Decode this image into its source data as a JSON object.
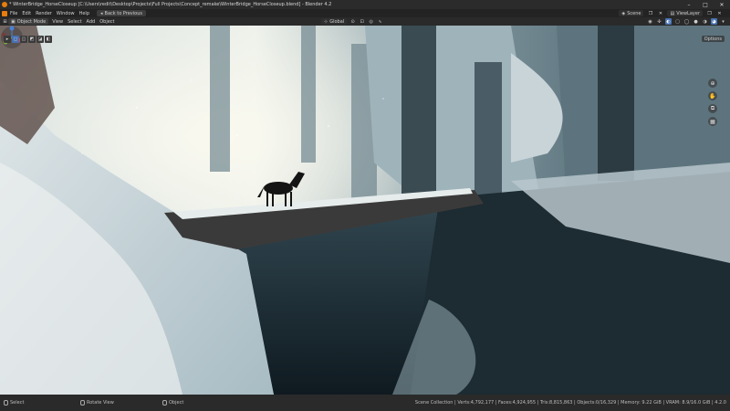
{
  "titlebar": {
    "title": "* WinterBridge_HorseCloseup [C:\\Users\\redit\\Desktop\\Projects\\Full Projects\\Concept_remake\\WinterBridge_HorseCloseup.blend] - Blender 4.2",
    "minimize": "–",
    "maximize": "□",
    "close": "✕"
  },
  "menubar": {
    "items": [
      "File",
      "Edit",
      "Render",
      "Window",
      "Help"
    ],
    "back_label": "Back to Previous",
    "scene": "Scene",
    "view_layer": "ViewLayer"
  },
  "viewport_header": {
    "mode": "Object Mode",
    "items": [
      "View",
      "Select",
      "Add",
      "Object"
    ],
    "orientation": "Global",
    "options": "Options"
  },
  "statusbar": {
    "select": "Select",
    "rotate": "Rotate View",
    "object": "Object",
    "stats": "Scene Collection | Verts:4,792,177 | Faces:4,924,955 | Tris:8,815,863 | Objects:0/16,329 | Memory: 9.22 GiB | VRAM: 8.9/16.0 GiB | 4.2.0"
  },
  "colors": {
    "accent": "#e87d0d",
    "active_blue": "#4772b3"
  }
}
